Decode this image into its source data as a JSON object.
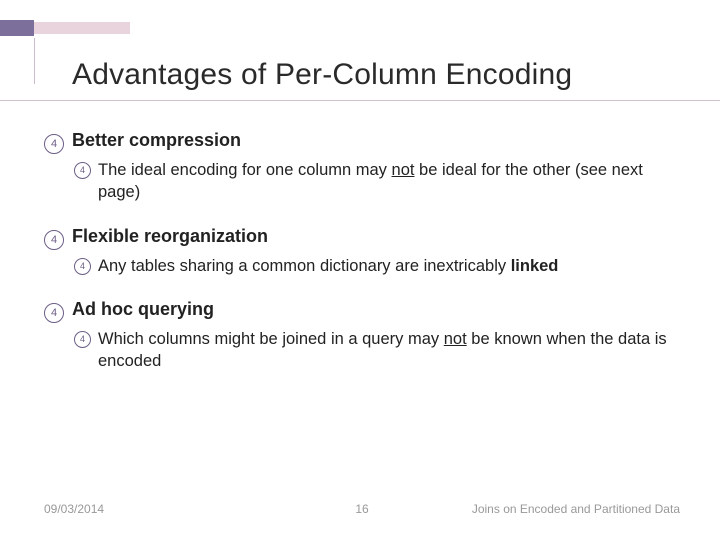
{
  "title": "Advantages of Per-Column Encoding",
  "bullets": [
    {
      "head": "Better compression",
      "sub_parts": [
        "The ideal encoding for one column may ",
        "not",
        " be ideal for the other (see next page)"
      ],
      "sub_style": [
        "",
        "u",
        ""
      ]
    },
    {
      "head": "Flexible reorganization",
      "sub_parts": [
        "Any tables sharing a common dictionary are inextricably ",
        "linked"
      ],
      "sub_style": [
        "",
        "b"
      ]
    },
    {
      "head": "Ad hoc querying",
      "sub_parts": [
        "Which columns might be joined in a query may ",
        "not",
        " be known when the data is encoded"
      ],
      "sub_style": [
        "",
        "u",
        ""
      ]
    }
  ],
  "footer": {
    "date": "09/03/2014",
    "page": "16",
    "label": "Joins on Encoded and Partitioned Data"
  },
  "bullet_glyph": "4"
}
